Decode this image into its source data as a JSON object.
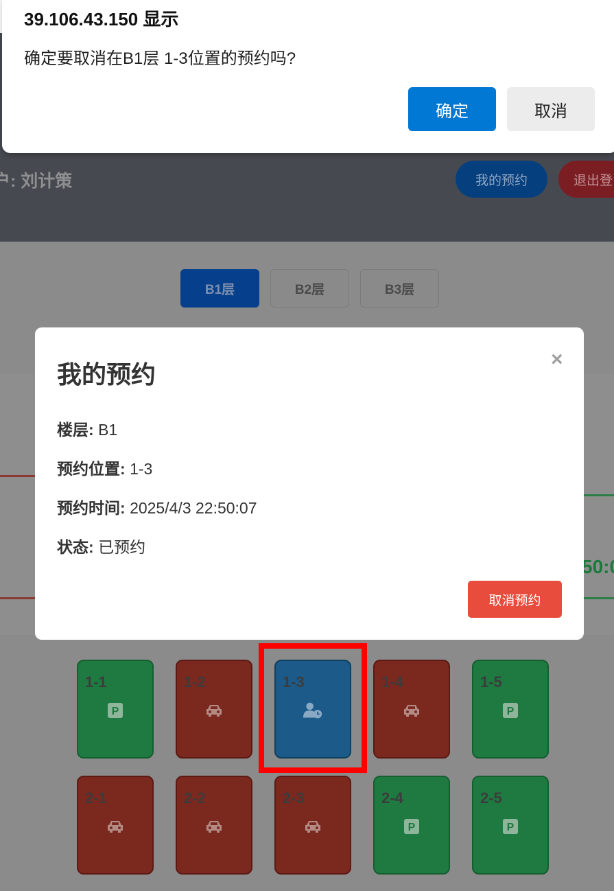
{
  "confirm_dialog": {
    "origin": "39.106.43.150 显示",
    "message": "确定要取消在B1层 1-3位置的预约吗?",
    "ok_label": "确定",
    "cancel_label": "取消"
  },
  "header": {
    "user_label": "户: 刘计策",
    "my_reservations_label": "我的预约",
    "logout_label": "退出登"
  },
  "floors": [
    {
      "label": "B1层",
      "active": true
    },
    {
      "label": "B2层",
      "active": false
    },
    {
      "label": "B3层",
      "active": false
    }
  ],
  "modal": {
    "title": "我的预约",
    "close_icon": "×",
    "rows": [
      {
        "label": "楼层:",
        "value": "B1"
      },
      {
        "label": "预约位置:",
        "value": "1-3"
      },
      {
        "label": "预约时间:",
        "value": "2025/4/3 22:50:07"
      },
      {
        "label": "状态:",
        "value": "已预约"
      }
    ],
    "cancel_button": "取消预约"
  },
  "background_peek": "50:0",
  "parking_spots": [
    {
      "id": "1-1",
      "status": "available",
      "icon": "parking-icon"
    },
    {
      "id": "1-2",
      "status": "occupied",
      "icon": "car-icon"
    },
    {
      "id": "1-3",
      "status": "reserved",
      "icon": "user-clock-icon"
    },
    {
      "id": "1-4",
      "status": "occupied",
      "icon": "car-icon"
    },
    {
      "id": "1-5",
      "status": "available",
      "icon": "parking-icon"
    },
    {
      "id": "2-1",
      "status": "occupied",
      "icon": "car-icon"
    },
    {
      "id": "2-2",
      "status": "occupied",
      "icon": "car-icon"
    },
    {
      "id": "2-3",
      "status": "occupied",
      "icon": "car-icon"
    },
    {
      "id": "2-4",
      "status": "available",
      "icon": "parking-icon"
    },
    {
      "id": "2-5",
      "status": "available",
      "icon": "parking-icon"
    }
  ],
  "colors": {
    "available": "#1e7a40",
    "occupied": "#7b281f",
    "reserved": "#1c5a8a",
    "dialog_ok": "#0078d4",
    "cancel_reservation": "#e74c3c",
    "highlight": "#ff0000"
  }
}
